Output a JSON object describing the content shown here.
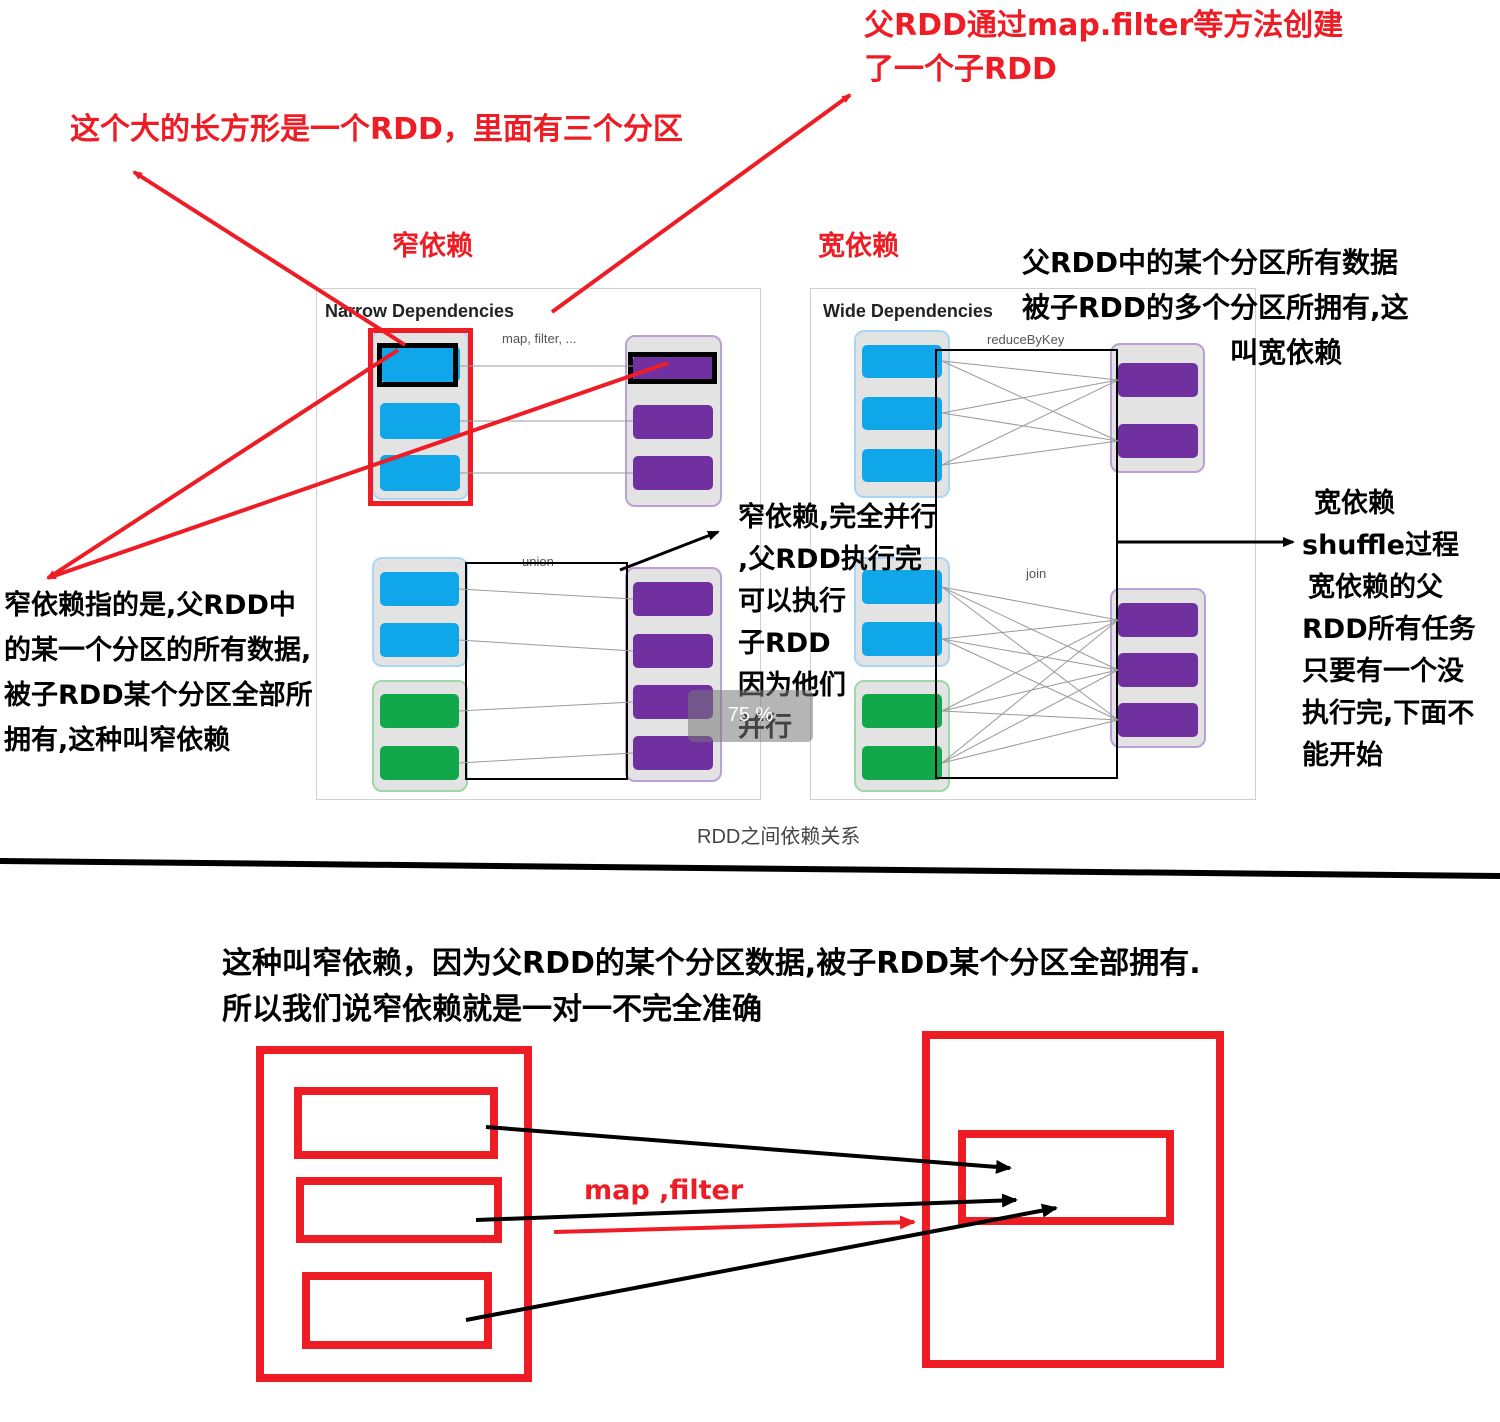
{
  "top_annotations": {
    "parent_creates_child": [
      "父RDD通过map.filter等方法创建",
      "了一个子RDD"
    ],
    "big_rect_is_rdd": "这个大的长方形是一个RDD，里面有三个分区",
    "narrow_title_cn": "窄依赖",
    "wide_title_cn": "宽依赖",
    "wide_explain": [
      "父RDD中的某个分区所有数据",
      "被子RDD的多个分区所拥有,这",
      "叫宽依赖"
    ],
    "narrow_explain": [
      "窄依赖指的是,父RDD中",
      "的某一个分区的所有数据,",
      "被子RDD某个分区全部所",
      "拥有,这种叫窄依赖"
    ],
    "narrow_parallel": [
      "窄依赖,完全并行",
      ",父RDD执行完",
      "可以执行",
      "子RDD",
      "因为他们",
      "并行"
    ],
    "wide_shuffle": [
      "宽依赖",
      "shuffle过程",
      "宽依赖的父",
      "RDD所有任务",
      "只要有一个没",
      "执行完,下面不",
      "能开始"
    ]
  },
  "diagram": {
    "narrow_panel_title": "Narrow Dependencies",
    "narrow_map_label": "map, filter, ...",
    "narrow_union_label": "union",
    "wide_panel_title": "Wide Dependencies",
    "wide_reduce_label": "reduceByKey",
    "wide_join_label": "join",
    "caption": "RDD之间依赖关系",
    "zoom_badge": "75 %"
  },
  "bottom": {
    "line1": "这种叫窄依赖，因为父RDD的某个分区数据,被子RDD某个分区全部拥有.",
    "line2": "所以我们说窄依赖就是一对一不完全准确",
    "map_filter_label": "map ,filter"
  },
  "colors": {
    "annotation_red": "#ee1c25",
    "partition_blue": "#0fa6ea",
    "partition_purple": "#7030a0",
    "partition_green": "#11a84a"
  }
}
